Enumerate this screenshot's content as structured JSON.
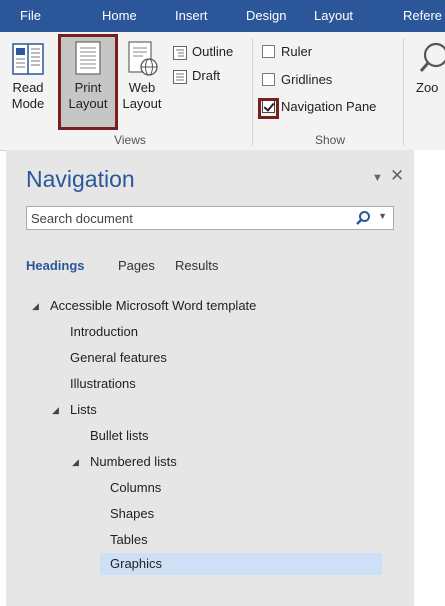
{
  "ribbon_tabs": [
    "File",
    "Home",
    "Insert",
    "Design",
    "Layout",
    "Refere"
  ],
  "views_group": {
    "read_mode": [
      "Read",
      "Mode"
    ],
    "print_layout": [
      "Print",
      "Layout"
    ],
    "web_layout": [
      "Web",
      "Layout"
    ],
    "outline": "Outline",
    "draft": "Draft",
    "label": "Views"
  },
  "show_group": {
    "ruler": "Ruler",
    "gridlines": "Gridlines",
    "navigation_pane": "Navigation Pane",
    "label": "Show"
  },
  "zoom_group": {
    "zoom": "Zoo"
  },
  "nav_pane": {
    "title": "Navigation",
    "search_placeholder": "Search document",
    "tabs": {
      "headings": "Headings",
      "pages": "Pages",
      "results": "Results"
    },
    "tree": [
      {
        "text": "Accessible Microsoft Word template",
        "expanded": true
      },
      {
        "text": "Introduction"
      },
      {
        "text": "General features"
      },
      {
        "text": "Illustrations"
      },
      {
        "text": "Lists",
        "expanded": true
      },
      {
        "text": "Bullet lists"
      },
      {
        "text": "Numbered lists",
        "expanded": true
      },
      {
        "text": "Columns"
      },
      {
        "text": "Shapes"
      },
      {
        "text": "Tables"
      },
      {
        "text": "Graphics",
        "selected": true
      }
    ]
  },
  "colors": {
    "ribbon_tab_bar": "#2b579a",
    "accent": "#2b579a",
    "highlight_box": "#7b1e1e",
    "selected_heading": "#cde0f5"
  }
}
